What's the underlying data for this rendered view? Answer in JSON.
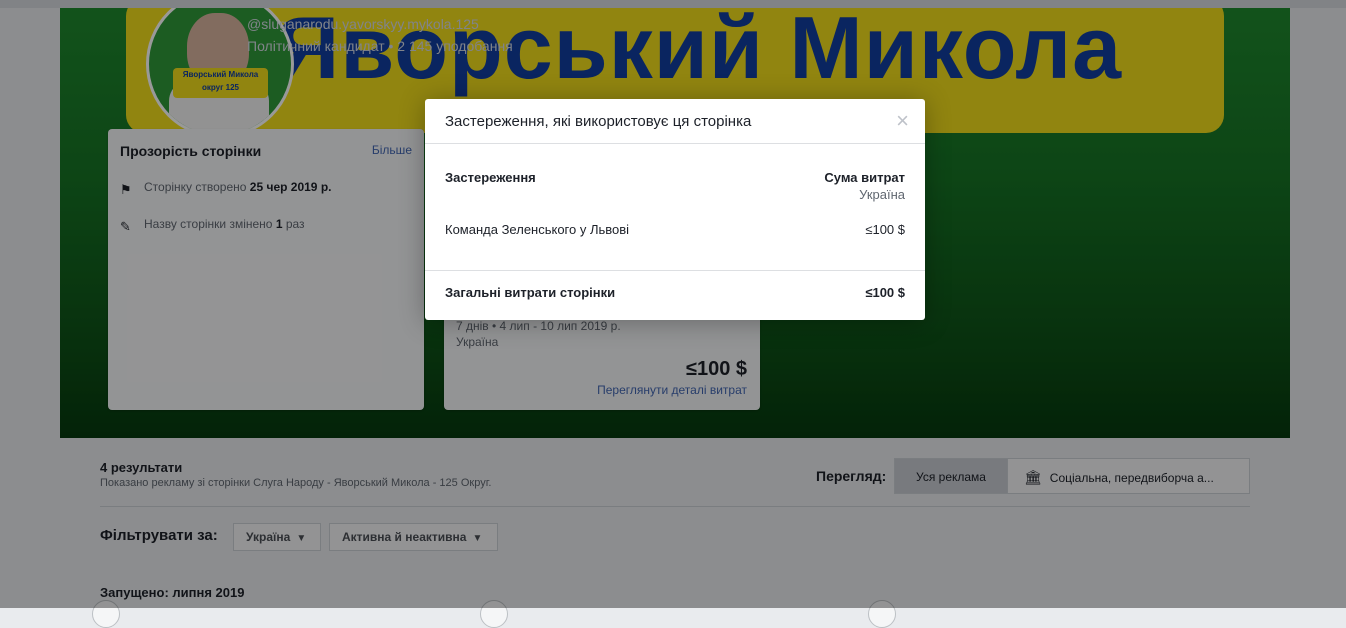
{
  "page": {
    "handle": "@sluganarodu.yavorskyy.mykola.125",
    "category": "Політичний кандидат",
    "likes": "2 145 уподобання",
    "banner_text": "Яворський Микола",
    "avatar_plate_name": "Яворський Микола",
    "avatar_plate_district": "округ 125"
  },
  "transparency": {
    "title": "Прозорість сторінки",
    "more": "Більше",
    "created_prefix": "Сторінку створено",
    "created_date": "25 чер 2019 р.",
    "renamed_prefix": "Назву сторінки змінено",
    "renamed_count": "1",
    "renamed_suffix": "раз",
    "flag_icon": "flag-icon",
    "edit_icon": "pencil-icon"
  },
  "spend_card": {
    "dates": "7 днів • 4 лип - 10 лип 2019 р.",
    "country": "Україна",
    "amount": "≤100 $",
    "details_link": "Переглянути деталі витрат"
  },
  "results": {
    "count": "4 результати",
    "subtitle": "Показано рекламу зі сторінки Слуга Народу - Яворський Микола - 125 Округ."
  },
  "view": {
    "label": "Перегляд:",
    "all_ads": "Уся реклама",
    "social": "Соціальна, передвиборча а..."
  },
  "filters": {
    "label": "Фільтрувати за:",
    "country": "Україна",
    "status": "Активна й неактивна"
  },
  "launched": "Запущено: липня 2019",
  "modal": {
    "title": "Застереження, які використовує ця сторінка",
    "close": "×",
    "col_disclaimer": "Застереження",
    "col_spend": "Сума витрат",
    "col_spend_region": "Україна",
    "rows": [
      {
        "name": "Команда Зеленського у Львові",
        "value": "≤100 $"
      }
    ],
    "total_label": "Загальні витрати сторінки",
    "total_value": "≤100 $"
  },
  "colors": {
    "banner_yellow": "#f2de1b",
    "banner_text_blue": "#123ea0",
    "cover_green": "#167324",
    "link_blue": "#4267b2"
  }
}
